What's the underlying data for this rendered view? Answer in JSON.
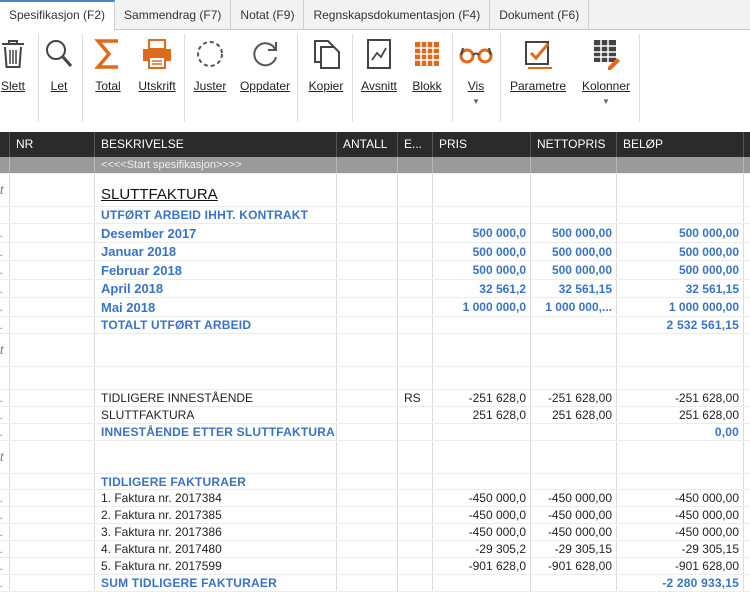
{
  "tabs": [
    {
      "label": "Spesifikasjon (F2)",
      "active": true
    },
    {
      "label": "Sammendrag (F7)",
      "active": false
    },
    {
      "label": "Notat (F9)",
      "active": false
    },
    {
      "label": "Regnskapsdokumentasjon (F4)",
      "active": false
    },
    {
      "label": "Dokument (F6)",
      "active": false
    }
  ],
  "toolbar": {
    "slett": "Slett",
    "let": "Let",
    "total": "Total",
    "utskrift": "Utskrift",
    "juster": "Juster",
    "oppdater": "Oppdater",
    "kopier": "Kopier",
    "avsnitt": "Avsnitt",
    "blokk": "Blokk",
    "vis": "Vis",
    "parametre": "Parametre",
    "kolonner": "Kolonner"
  },
  "colors": {
    "header_bg": "#2b2b2b",
    "accent_blue": "#3a73c4",
    "icon_orange": "#e06a1b",
    "icon_gray": "#555555"
  },
  "grid": {
    "columns": {
      "nr": "NR",
      "beskrivelse": "BESKRIVELSE",
      "antall": "ANTALL",
      "e": "E...",
      "pris": "PRIS",
      "nettopris": "NETTOPRIS",
      "belop": "BELØP"
    },
    "rows": [
      {
        "lead": "",
        "beskrivelse": "<<<<Start spesifikasjon>>>>",
        "e": "",
        "pris": "",
        "nettopris": "",
        "belop": "",
        "style": "start"
      },
      {
        "lead": "t",
        "beskrivelse": "SLUTTFAKTURA",
        "e": "",
        "pris": "",
        "nettopris": "",
        "belop": "",
        "style": "title"
      },
      {
        "lead": "",
        "beskrivelse": "UTFØRT ARBEID IHHT. KONTRAKT",
        "e": "",
        "pris": "",
        "nettopris": "",
        "belop": "",
        "style": "head"
      },
      {
        "lead": ".",
        "beskrivelse": "Desember 2017",
        "e": "",
        "pris": "500 000,0",
        "nettopris": "500 000,00",
        "belop": "500 000,00",
        "style": "big"
      },
      {
        "lead": ".",
        "beskrivelse": "Januar 2018",
        "e": "",
        "pris": "500 000,0",
        "nettopris": "500 000,00",
        "belop": "500 000,00",
        "style": "big"
      },
      {
        "lead": ".",
        "beskrivelse": "Februar 2018",
        "e": "",
        "pris": "500 000,0",
        "nettopris": "500 000,00",
        "belop": "500 000,00",
        "style": "big"
      },
      {
        "lead": ".",
        "beskrivelse": "April 2018",
        "e": "",
        "pris": "32 561,2",
        "nettopris": "32 561,15",
        "belop": "32 561,15",
        "style": "big"
      },
      {
        "lead": ".",
        "beskrivelse": "Mai 2018",
        "e": "",
        "pris": "1 000 000,0",
        "nettopris": "1 000 000,...",
        "belop": "1 000 000,00",
        "style": "big"
      },
      {
        "lead": ".",
        "beskrivelse": "TOTALT UTFØRT ARBEID",
        "e": "",
        "pris": "",
        "nettopris": "",
        "belop": "2 532 561,15",
        "style": "head"
      },
      {
        "lead": "t",
        "beskrivelse": "",
        "e": "",
        "pris": "",
        "nettopris": "",
        "belop": "",
        "style": "blank"
      },
      {
        "lead": "",
        "beskrivelse": "",
        "e": "",
        "pris": "",
        "nettopris": "",
        "belop": "",
        "style": "blank"
      },
      {
        "lead": ".",
        "beskrivelse": "TIDLIGERE INNESTÅENDE",
        "e": "RS",
        "pris": "-251 628,0",
        "nettopris": "-251 628,00",
        "belop": "-251 628,00",
        "style": "norm"
      },
      {
        "lead": ".",
        "beskrivelse": "SLUTTFAKTURA",
        "e": "",
        "pris": "251 628,0",
        "nettopris": "251 628,00",
        "belop": "251 628,00",
        "style": "norm"
      },
      {
        "lead": ".",
        "beskrivelse": "INNESTÅENDE ETTER SLUTTFAKTURA",
        "e": "",
        "pris": "",
        "nettopris": "",
        "belop": "0,00",
        "style": "head"
      },
      {
        "lead": "t",
        "beskrivelse": "",
        "e": "",
        "pris": "",
        "nettopris": "",
        "belop": "",
        "style": "blank"
      },
      {
        "lead": "",
        "beskrivelse": "TIDLIGERE FAKTURAER",
        "e": "",
        "pris": "",
        "nettopris": "",
        "belop": "",
        "style": "head"
      },
      {
        "lead": ".",
        "beskrivelse": "1. Faktura nr. 2017384",
        "e": "",
        "pris": "-450 000,0",
        "nettopris": "-450 000,00",
        "belop": "-450 000,00",
        "style": "norm"
      },
      {
        "lead": ".",
        "beskrivelse": "2. Faktura nr. 2017385",
        "e": "",
        "pris": "-450 000,0",
        "nettopris": "-450 000,00",
        "belop": "-450 000,00",
        "style": "norm"
      },
      {
        "lead": ".",
        "beskrivelse": "3. Faktura nr. 2017386",
        "e": "",
        "pris": "-450 000,0",
        "nettopris": "-450 000,00",
        "belop": "-450 000,00",
        "style": "norm"
      },
      {
        "lead": ".",
        "beskrivelse": "4. Faktura nr. 2017480",
        "e": "",
        "pris": "-29 305,2",
        "nettopris": "-29 305,15",
        "belop": "-29 305,15",
        "style": "norm"
      },
      {
        "lead": ".",
        "beskrivelse": "5. Faktura nr. 2017599",
        "e": "",
        "pris": "-901 628,0",
        "nettopris": "-901 628,00",
        "belop": "-901 628,00",
        "style": "norm"
      },
      {
        "lead": ".",
        "beskrivelse": "SUM TIDLIGERE FAKTURAER",
        "e": "",
        "pris": "",
        "nettopris": "",
        "belop": "-2 280 933,15",
        "style": "head"
      }
    ]
  }
}
